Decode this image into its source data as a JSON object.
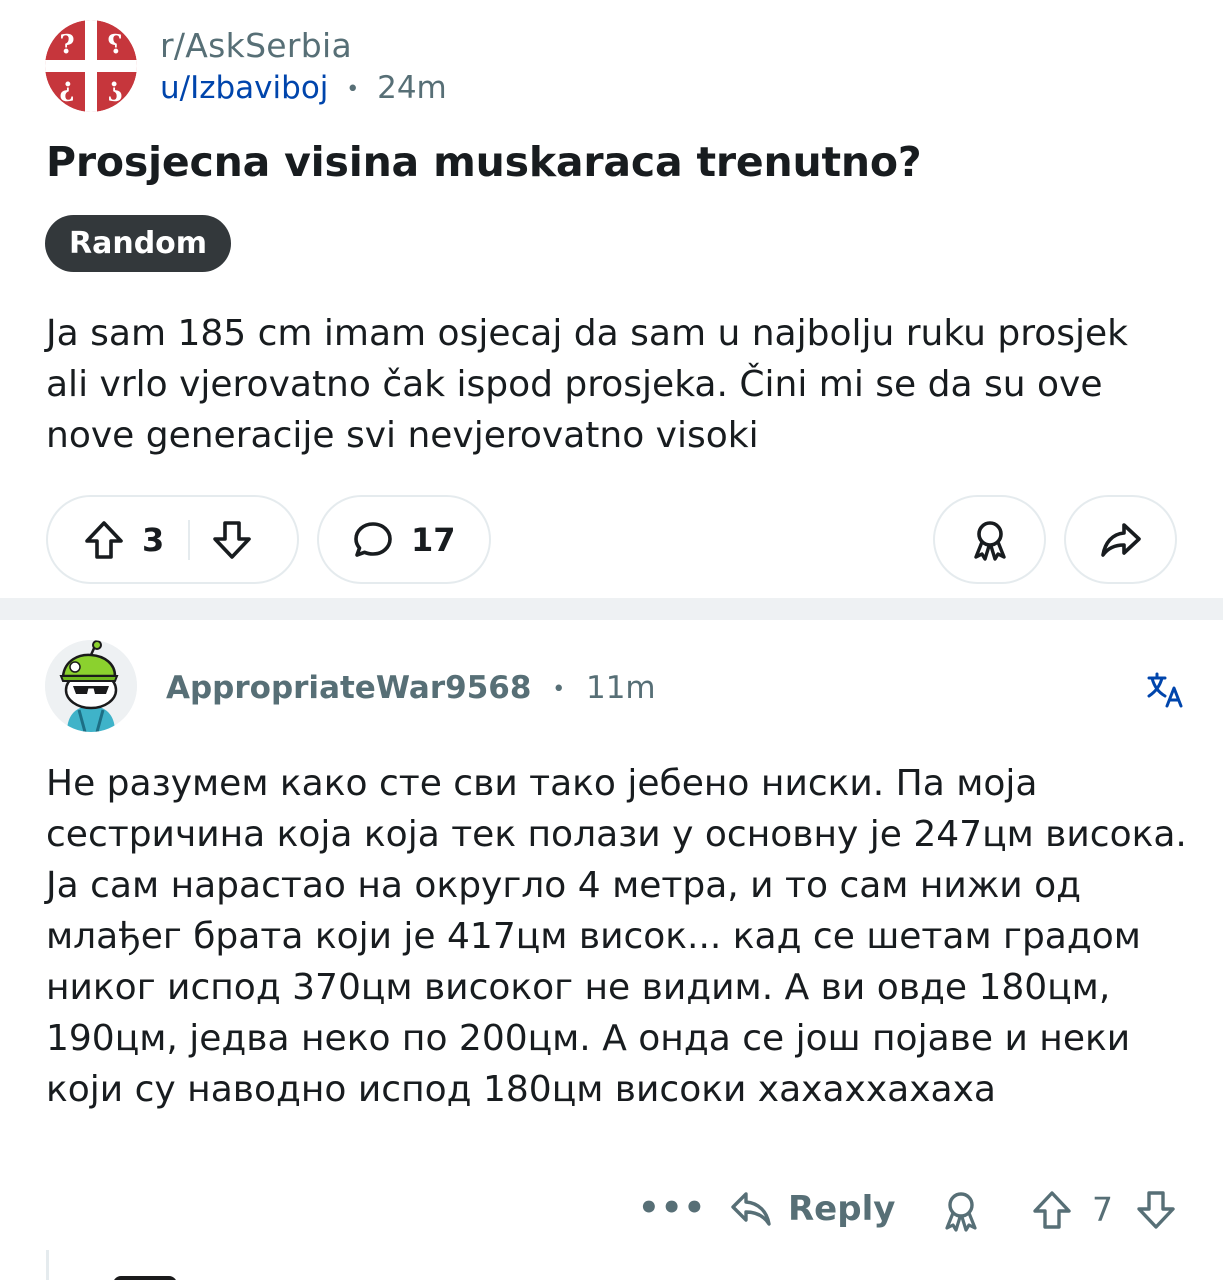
{
  "post": {
    "subreddit": "r/AskSerbia",
    "author": "u/Izbaviboj",
    "separator": "•",
    "age": "24m",
    "title": "Prosjecna visina muskaraca trenutno?",
    "flair": "Random",
    "body": "Ja sam 185 cm imam osjecaj da sam u najbolju ruku prosjek ali vrlo vjerovatno čak ispod prosjeka. Čini mi se da su ove nove generacije svi nevjerovatno visoki",
    "upvotes": "3",
    "comments": "17",
    "icons": {
      "subreddit": "serbian-cross-question-marks-icon",
      "upvote": "arrow-up-icon",
      "downvote": "arrow-down-icon",
      "comment": "speech-bubble-icon",
      "award": "award-ribbon-icon",
      "share": "share-arrow-icon"
    }
  },
  "comment": {
    "author": "AppropriateWar9568",
    "separator": "•",
    "age": "11m",
    "body": "Не разумем како сте сви тако јебено ниски. Па моја сестричина која која тек полази у основну је 247цм висока. Ја сам нарастао на округло 4 метра, и то сам нижи од млађег брата који је 417цм висок... кад се шетам градом никог испод 370цм високог не видим. А ви овде 180цм, 190цм, једва неко по 200цм. А онда се још појаве и неки који су наводно испод 180цм високи хахаххахаха",
    "more_label": "•••",
    "reply_label": "Reply",
    "votes": "7",
    "icons": {
      "avatar": "snoo-avatar-green-cap-sunglasses",
      "translate": "translate-icon",
      "reply": "reply-arrow-icon"
    }
  },
  "colors": {
    "meta_gray": "#576f76",
    "user_link": "#0045ac",
    "flair_bg": "#33383b",
    "pill_border": "#e5ebee",
    "separator_band": "#eef1f3",
    "serbian_red": "#c6363c"
  }
}
